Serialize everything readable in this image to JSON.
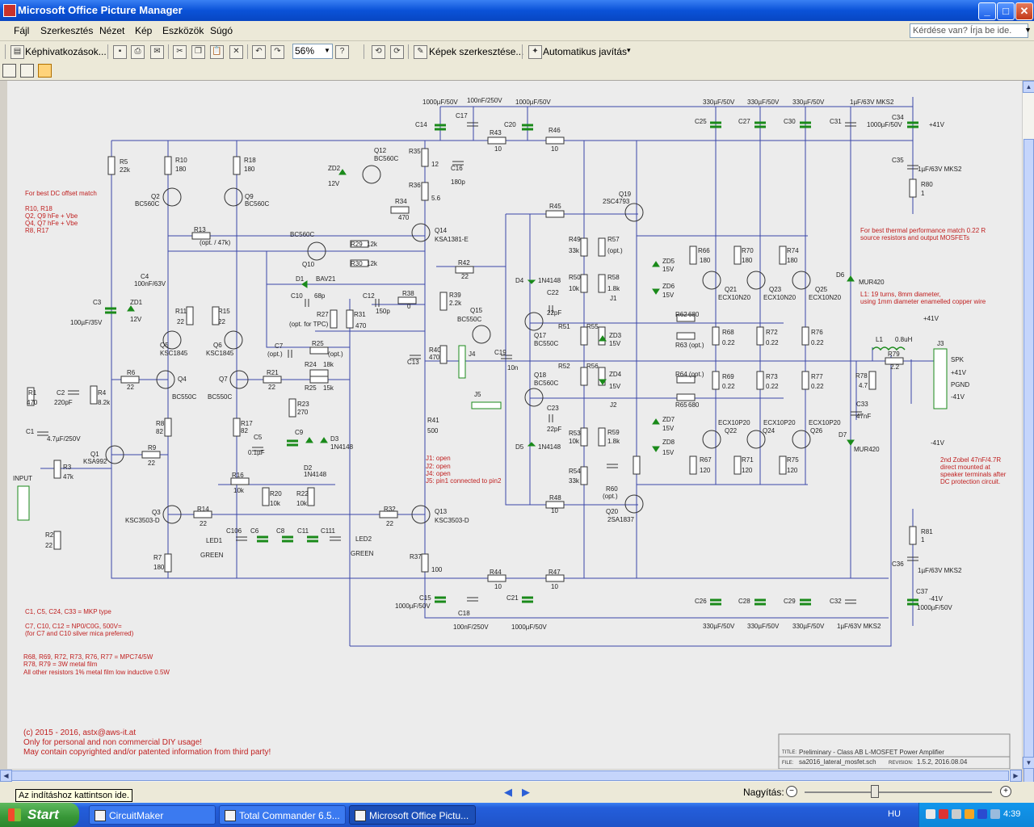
{
  "window": {
    "title": "Microsoft Office Picture Manager",
    "buttons": {
      "minimize": "_",
      "maximize": "□",
      "close": "✕"
    }
  },
  "menu": {
    "items": [
      "Fájl",
      "Szerkesztés",
      "Nézet",
      "Kép",
      "Eszközök",
      "Súgó"
    ],
    "help_placeholder": "Kérdése van? Írja be ide."
  },
  "toolbar": {
    "shortcuts_label": "Képhivatkozások...",
    "zoom_value": "56%",
    "edit_images_label": "Képek szerkesztése...",
    "auto_fix_label": "Automatikus javítás"
  },
  "schematic": {
    "title_block": {
      "title_label": "TITLE:",
      "title_value": "Preliminary - Class AB L-MOSFET Power Amplifier",
      "file_label": "FILE:",
      "file_value": "sa2016_lateral_mosfet.sch",
      "revision_label": "REVISION:",
      "revision_value": "1.5.2, 2016.08.04"
    },
    "copyright": [
      "(c) 2015 - 2016, astx@aws-it.at",
      "Only for personal and non commercial DIY usage!",
      "May contain copyrighted and/or patented information from third party!"
    ],
    "notes_left": [
      "For best DC offset match",
      "R10, R18",
      "Q2, Q9 hFe + Vbe",
      "Q4, Q7 hFe + Vbe",
      "R8, R17"
    ],
    "notes_bottom": [
      "C1, C5, C24, C33 = MKP type",
      "C7, C10, C12 = NP0/C0G, 500V=",
      "(for C7 and C10 silver mica preferred)",
      "R68, R69, R72, R73, R76, R77 = MPC74/5W",
      "R78, R79 = 3W metal film",
      "All other resistors 1% metal film low inductive 0.5W"
    ],
    "notes_right": [
      "For best thermal performance match 0.22 R",
      "source resistors and output MOSFETs",
      "L1: 19 turns, 8mm diameter,",
      "using 1mm diameter enamelled copper wire",
      "2nd Zobel 47nF/4.7R",
      "direct mounted at",
      "speaker terminals after",
      "DC protection circuit."
    ],
    "jumpers": [
      "J1: open",
      "J2: open",
      "J4: open",
      "J5: pin1 connected to pin2"
    ],
    "supply_pos": "+41V",
    "supply_neg": "-41V",
    "input_label": "INPUT",
    "output_label": "J3",
    "output_pins": [
      "SPK",
      "+41V",
      "PGND",
      "-41V"
    ],
    "cap_top": [
      "1000µF/50V",
      "100nF/250V",
      "1000µF/50V",
      "330µF/50V",
      "330µF/50V",
      "330µF/50V",
      "1µF/63V MKS2"
    ],
    "cap_bottom": [
      "1000µF/50V",
      "100nF/250V",
      "1000µF/50V",
      "330µF/50V",
      "330µF/50V",
      "330µF/50V",
      "1µF/63V MKS2"
    ]
  },
  "status": {
    "tooltip": "Az indításhoz kattintson ide.",
    "zoom_label": "Nagyítás:",
    "zoom_out": "−",
    "zoom_in": "+"
  },
  "taskbar": {
    "start_label": "Start",
    "tasks": [
      "CircuitMaker",
      "Total Commander 6.5...",
      "Microsoft Office Pictu..."
    ],
    "language": "HU",
    "clock": "4:39"
  }
}
